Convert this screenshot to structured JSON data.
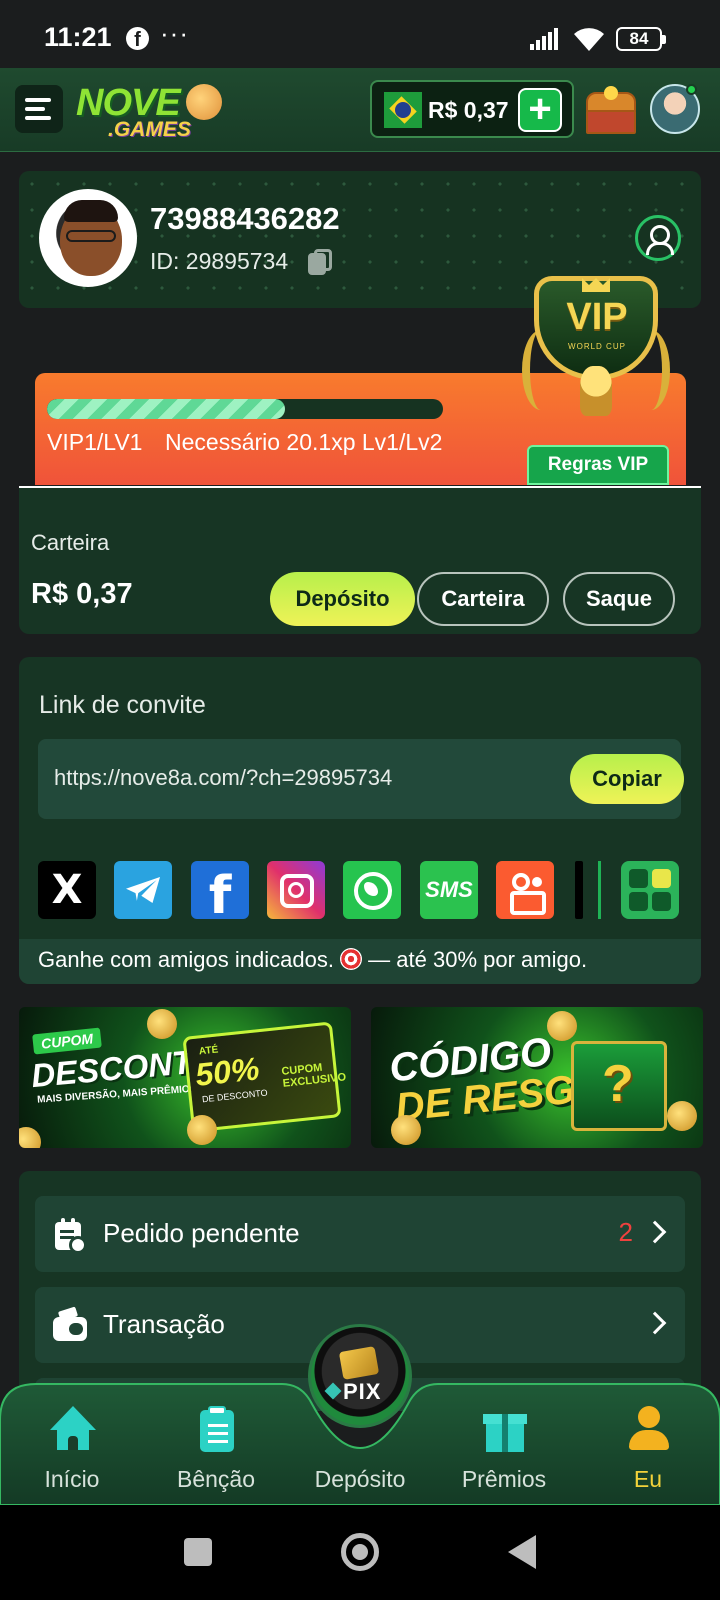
{
  "status_bar": {
    "time": "11:21",
    "dots": "···",
    "battery": "84"
  },
  "header": {
    "logo_main": "NOVE",
    "logo_sub": ".GAMES",
    "balance": "R$ 0,37",
    "plus": "+"
  },
  "profile": {
    "username": "73988436282",
    "id_label": "ID: 29895734"
  },
  "vip": {
    "badge_text": "VIP",
    "badge_sub": "WORLD CUP",
    "progress_fraction": 0.6,
    "level": "VIP1/LV1",
    "requirement": "Necessário 20.1xp Lv1/Lv2",
    "rules_button": "Regras VIP"
  },
  "wallet": {
    "title": "Carteira",
    "amount": "R$ 0,37",
    "deposit_button": "Depósito",
    "wallet_button": "Carteira",
    "withdraw_button": "Saque"
  },
  "invite": {
    "title": "Link de convite",
    "link": "https://nove8a.com/?ch=29895734",
    "copy_button": "Copiar",
    "share_x": "X",
    "share_fb": "f",
    "share_sms": "SMS",
    "footer_text_1": "Ganhe com amigos indicados. ",
    "footer_text_2": " — até 30% por amigo."
  },
  "banners": {
    "discount": {
      "tag": "CUPOM",
      "headline": "DESCONTO",
      "sub": "MAIS DIVERSÃO, MAIS PRÊMIOS!",
      "ate": "ATÉ",
      "percent": "50%",
      "of_discount": "DE DESCONTO",
      "exclusive": "CUPOM EXCLUSIVO"
    },
    "redeem": {
      "line1": "CÓDIGO",
      "line2": "DE RESGATE",
      "symbol": "?"
    }
  },
  "menu": {
    "items": [
      {
        "label": "Pedido pendente",
        "count": "2"
      },
      {
        "label": "Transação",
        "count": ""
      }
    ]
  },
  "bottom_nav": {
    "items": [
      {
        "label": "Início"
      },
      {
        "label": "Bênção"
      },
      {
        "label": "Depósito"
      },
      {
        "label": "Prêmios"
      },
      {
        "label": "Eu"
      }
    ],
    "center_badge": "PIX",
    "active": "Eu"
  }
}
